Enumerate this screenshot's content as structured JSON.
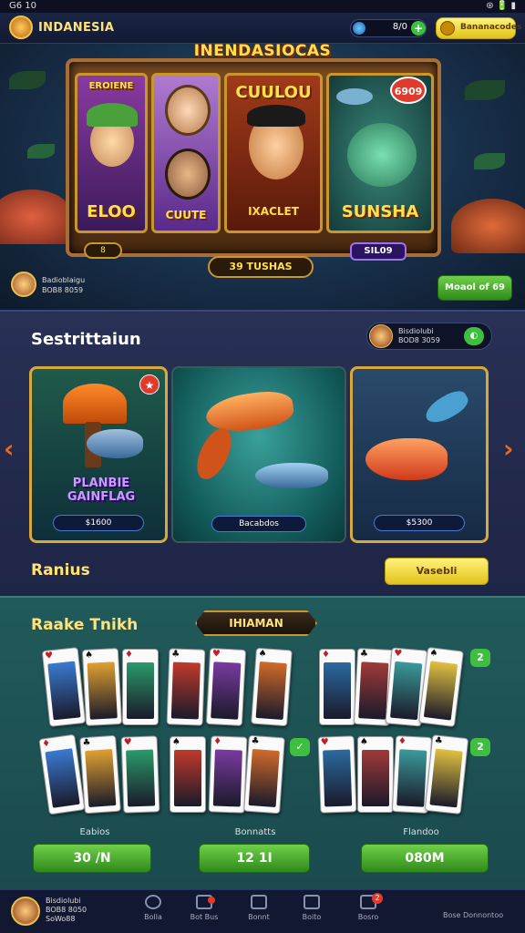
{
  "status_bar": {
    "left": "G6 10",
    "right": "⊛ 🔋 ▮"
  },
  "header": {
    "brand": "INDANESIA",
    "coins": "8/0",
    "coin_plus": "+",
    "wallet_label": "Bananacodes"
  },
  "hero": {
    "title": "INENDASIOCAS",
    "cards": [
      {
        "label": "ELOO",
        "top_label": "EROIENE"
      },
      {
        "label": "CUUTE"
      },
      {
        "label": "IXACLET",
        "top_label": "CUULOU"
      },
      {
        "label": "SUNSHA"
      }
    ],
    "badge": "6909",
    "small_pill": "8",
    "main_pill": "39 TUSHAS",
    "sale_pill": "SIL09",
    "user_text": [
      "Badioblaigu",
      "BOB8 8059"
    ],
    "button": "Moaol of 69"
  },
  "section2": {
    "title": "Sestrittaiun",
    "player_text": [
      "Bisdiolubi",
      "BOD8 3059"
    ],
    "games": [
      {
        "label": "PLANBIE GAINFLAG",
        "pill": "$1600"
      },
      {
        "pill": "Bacabdos"
      },
      {
        "pill": "$5300"
      }
    ],
    "ranks_title": "Ranius",
    "ranks_button": "Vasebli"
  },
  "section3": {
    "title": "Raake Tnikh",
    "banner": "IHIAMAN",
    "groups": [
      {
        "label": "Eabios",
        "button": "30 /N",
        "badge": ""
      },
      {
        "label": "Bonnatts",
        "button": "12 1I",
        "badge": "2"
      },
      {
        "label": "Flandoo",
        "button": "080M",
        "badge": "2"
      }
    ]
  },
  "nav": {
    "user_text": [
      "Bisdiolubi",
      "BOB8 8050",
      "SoWo88"
    ],
    "items": [
      "Bolla",
      "Bot Bus",
      "Bonnt",
      "Boito",
      "Bosro"
    ],
    "badge": "2",
    "right_text": "Bose Donnontoo"
  },
  "colors": {
    "accent": "#ffe27a",
    "green": "#3fbf3f",
    "red": "#e23a2a",
    "gold": "#c9962e"
  }
}
